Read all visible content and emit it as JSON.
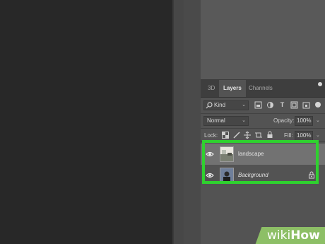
{
  "tabs": [
    {
      "label": "3D",
      "active": false
    },
    {
      "label": "Layers",
      "active": true
    },
    {
      "label": "Channels",
      "active": false
    }
  ],
  "filter": {
    "value": "Kind",
    "icon": "search-icon"
  },
  "filter_icons": [
    "image-filter-icon",
    "adjustment-filter-icon",
    "text-filter-icon",
    "shape-filter-icon",
    "smart-object-filter-icon"
  ],
  "blend": {
    "mode": "Normal",
    "opacity_label": "Opacity:",
    "opacity_value": "100%"
  },
  "lock": {
    "label": "Lock:",
    "fill_label": "Fill:",
    "fill_value": "100%"
  },
  "layers": [
    {
      "name": "landscape",
      "selected": true,
      "italic": false,
      "locked": false
    },
    {
      "name": "Background",
      "selected": false,
      "italic": true,
      "locked": true
    }
  ],
  "watermark": {
    "prefix": "wiki",
    "suffix": "How"
  },
  "colors": {
    "highlight": "#2fd12f",
    "panel_bg": "#535353",
    "canvas_bg": "#282828",
    "selected_row": "#727272"
  }
}
